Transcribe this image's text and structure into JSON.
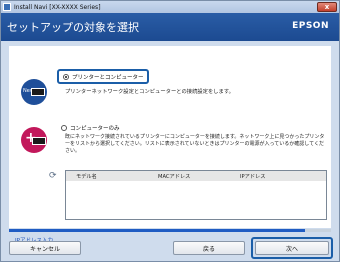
{
  "window": {
    "title": "Install Navi [XX-XXXX Series]",
    "close_glyph": "x"
  },
  "header": {
    "title": "セットアップの対象を選択",
    "brand": "EPSON"
  },
  "options": [
    {
      "label": "プリンターとコンピューター",
      "icon_text": "New",
      "description": "プリンターネットワーク設定とコンピューターとの接続設定をします。",
      "selected": true
    },
    {
      "label": "コンピューターのみ",
      "icon_text": "+",
      "description": "既にネットワーク接続されているプリンターにコンピューターを接続します。ネットワーク上に見つかったプリンターをリストから選択してください。リストに表示されていないときはプリンターの電源が入っているか確認してください。",
      "selected": false
    }
  ],
  "table": {
    "columns": [
      "モデル名",
      "MACアドレス",
      "IPアドレス"
    ]
  },
  "links": {
    "ip_address": "IPアドレス入力"
  },
  "buttons": {
    "cancel": "キャンセル",
    "back": "戻る",
    "next": "次へ"
  },
  "progress": {
    "value": 0.92
  },
  "icons": {
    "refresh": "refresh-icon"
  },
  "colors": {
    "header": "#2a5da6",
    "accent": "#1b5ea8",
    "new_icon": "#1f4f9a",
    "plus_icon": "#c2185b"
  }
}
